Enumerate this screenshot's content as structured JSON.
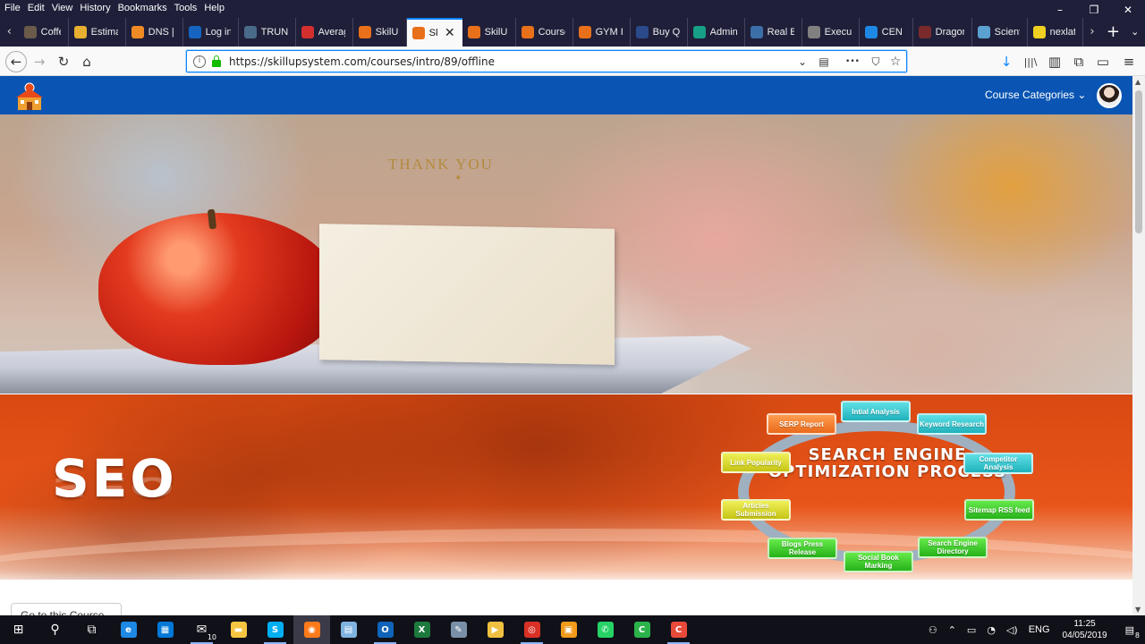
{
  "menubar": {
    "items": [
      "File",
      "Edit",
      "View",
      "History",
      "Bookmarks",
      "Tools",
      "Help"
    ]
  },
  "window_controls": {
    "minimize": "–",
    "restore": "❐",
    "close": "✕"
  },
  "tabs": [
    {
      "label": "Coffee",
      "color": "#6a5a4a",
      "active": false,
      "width": 56
    },
    {
      "label": "Estima",
      "color": "#e8b030",
      "active": false,
      "width": 64
    },
    {
      "label": "DNS |",
      "color": "#f08a24",
      "active": false,
      "width": 64
    },
    {
      "label": "Log in",
      "color": "#1565c0",
      "active": false,
      "width": 62
    },
    {
      "label": "TRUN",
      "color": "#4a6a8a",
      "active": false,
      "width": 64
    },
    {
      "label": "Averag",
      "color": "#d32f2f",
      "active": false,
      "width": 64
    },
    {
      "label": "SkilUp",
      "color": "#e8701a",
      "active": false,
      "width": 60
    },
    {
      "label": "Ski",
      "color": "#e8701a",
      "active": true,
      "width": 62
    },
    {
      "label": "SkilUp",
      "color": "#e8701a",
      "active": false,
      "width": 60
    },
    {
      "label": "Course",
      "color": "#e8701a",
      "active": false,
      "width": 64
    },
    {
      "label": "GYM I",
      "color": "#e8701a",
      "active": false,
      "width": 64
    },
    {
      "label": "Buy Q",
      "color": "#2a4a8a",
      "active": false,
      "width": 64
    },
    {
      "label": "Admin",
      "color": "#16a085",
      "active": false,
      "width": 64
    },
    {
      "label": "Real E",
      "color": "#3c6ea8",
      "active": false,
      "width": 64
    },
    {
      "label": "Execut",
      "color": "#808080",
      "active": false,
      "width": 64
    },
    {
      "label": "CEN G",
      "color": "#1e88e5",
      "active": false,
      "width": 60
    },
    {
      "label": "Dragon Ca",
      "color": "#7a2a2a",
      "active": false,
      "width": 66
    },
    {
      "label": "Scient",
      "color": "#5aa0d0",
      "active": false,
      "width": 62
    },
    {
      "label": "nexlat",
      "color": "#f0d020",
      "active": false,
      "width": 62
    }
  ],
  "tab_controls": {
    "scroll_left": "‹",
    "scroll_right": "›",
    "new_tab": "+",
    "list_all": "⌄",
    "close": "✕"
  },
  "navbar": {
    "back": "←",
    "forward": "→",
    "reload": "↻",
    "home": "⌂",
    "url": "https://skillupsystem.com/courses/intro/89/offline",
    "info": "i",
    "dropdown": "⌄",
    "reader": "▤",
    "more": "•••",
    "pocket": "⛉",
    "bookmark": "☆",
    "download": "↓",
    "library": "|||\\",
    "sidebar": "▥",
    "extensions": "⧉",
    "screenshot": "▭",
    "menu": "≡"
  },
  "site": {
    "header": {
      "course_categories": "Course Categories ⌄"
    },
    "hero": {
      "card_text": "THANK YOU",
      "card_ornament": "✦"
    },
    "seo_banner": {
      "headline": "SEO",
      "diagram_title": "SEARCH ENGINE OPTIMIZATION PROCESS",
      "nodes": [
        {
          "label": "Intial Analysis",
          "style": "teal"
        },
        {
          "label": "Keyword Research",
          "style": "teal"
        },
        {
          "label": "Competitor Analysis",
          "style": "teal"
        },
        {
          "label": "Sitemap RSS feed",
          "style": "green"
        },
        {
          "label": "Search Engine Directory",
          "style": "green"
        },
        {
          "label": "Social Book Marking",
          "style": "green"
        },
        {
          "label": "Blogs Press Release",
          "style": "green"
        },
        {
          "label": "Articles Submission",
          "style": "yellow"
        },
        {
          "label": "Link Popularity",
          "style": "yellow"
        },
        {
          "label": "SERP Report",
          "style": "orange"
        }
      ]
    },
    "goto_course_button": "Go to this Course"
  },
  "taskbar": {
    "apps": [
      {
        "name": "windows-start-icon",
        "glyph": "⊞",
        "color": "",
        "state": ""
      },
      {
        "name": "search-icon",
        "glyph": "⚲",
        "color": "",
        "state": ""
      },
      {
        "name": "task-view-icon",
        "glyph": "⧉",
        "color": "",
        "state": ""
      },
      {
        "name": "edge-icon",
        "glyph": "e",
        "color": "#1e88e5",
        "state": ""
      },
      {
        "name": "store-icon",
        "glyph": "▦",
        "color": "#0078d7",
        "state": ""
      },
      {
        "name": "mail-icon",
        "glyph": "✉",
        "color": "",
        "state": "open",
        "badge": "10"
      },
      {
        "name": "file-explorer-icon",
        "glyph": "▬",
        "color": "#f5c542",
        "state": ""
      },
      {
        "name": "skype-icon",
        "glyph": "S",
        "color": "#00aff0",
        "state": "open"
      },
      {
        "name": "firefox-icon",
        "glyph": "◉",
        "color": "#ff7a1a",
        "state": "active"
      },
      {
        "name": "notepad-icon",
        "glyph": "▤",
        "color": "#7fb3e0",
        "state": ""
      },
      {
        "name": "outlook-icon",
        "glyph": "O",
        "color": "#0f63b8",
        "state": "open"
      },
      {
        "name": "excel-icon",
        "glyph": "X",
        "color": "#1d7a3e",
        "state": ""
      },
      {
        "name": "paint-icon",
        "glyph": "✎",
        "color": "#7a90a8",
        "state": ""
      },
      {
        "name": "media-player-icon",
        "glyph": "▶",
        "color": "#f0c040",
        "state": ""
      },
      {
        "name": "chrome-icon",
        "glyph": "◎",
        "color": "#d93025",
        "state": "open"
      },
      {
        "name": "image-viewer-icon",
        "glyph": "▣",
        "color": "#f29a1a",
        "state": ""
      },
      {
        "name": "whatsapp-icon",
        "glyph": "✆",
        "color": "#25d366",
        "state": ""
      },
      {
        "name": "camtasia-green-icon",
        "glyph": "C",
        "color": "#2bb24a",
        "state": ""
      },
      {
        "name": "camtasia-red-icon",
        "glyph": "C",
        "color": "#e84a3a",
        "state": "open"
      }
    ],
    "tray": {
      "people": "⚇",
      "chevron": "⌃",
      "battery": "▭",
      "network": "◔",
      "volume": "◁)",
      "language": "ENG",
      "time": "11:25",
      "date": "04/05/2019",
      "notifications": "▤",
      "notification_count": "8"
    }
  },
  "colors": {
    "site_header": "#0a55b3",
    "tab_active_accent": "#0a84ff",
    "chrome_dark": "#1f1f3a",
    "seo_orange": "#e8551a"
  }
}
